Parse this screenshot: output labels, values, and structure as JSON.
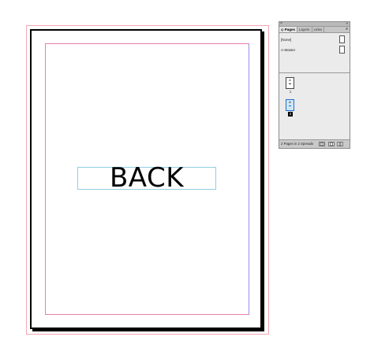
{
  "document": {
    "text_frame_text": "BACK"
  },
  "panel": {
    "close_glyph": "×",
    "menu_glyph": "»",
    "tabs": [
      {
        "label": "◇ Pages",
        "active": true
      },
      {
        "label": "Layers",
        "active": false
      },
      {
        "label": "Links",
        "active": false
      }
    ],
    "tab_menu_glyph": "≡",
    "masters": [
      {
        "label": "[None]"
      },
      {
        "label": "A-Master"
      }
    ],
    "pages": [
      {
        "master": "A",
        "number": "1",
        "selected": false
      },
      {
        "master": "A",
        "number": "2",
        "selected": true
      }
    ],
    "footer_text": "2 Pages in 2 Spreads",
    "icons": {
      "edit_page_size": "page-size-icon",
      "new_page": "new-page-icon",
      "delete": "trash-icon"
    }
  }
}
